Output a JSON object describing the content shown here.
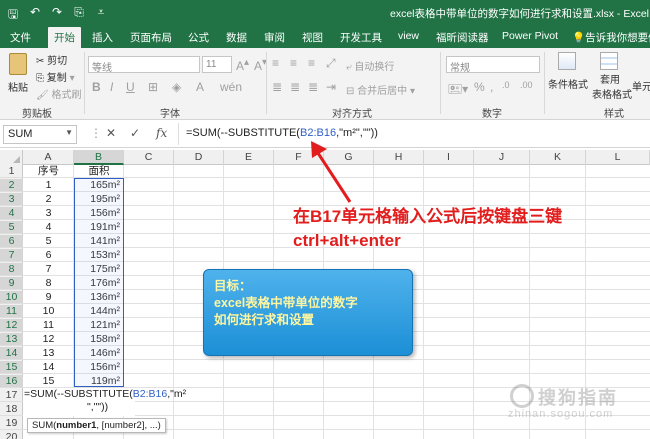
{
  "window": {
    "title": "excel表格中带单位的数字如何进行求和设置.xlsx - Excel"
  },
  "tabs": [
    "文件",
    "开始",
    "插入",
    "页面布局",
    "公式",
    "数据",
    "审阅",
    "视图",
    "开发工具",
    "view",
    "福昕阅读器",
    "Power Pivot",
    "告诉我你想要做什"
  ],
  "active_tab": "开始",
  "ribbon": {
    "paste": "粘贴",
    "cut": "剪切",
    "copy": "复制",
    "format_painter": "格式刷",
    "clipboard_group": "剪贴板",
    "font_name": "等线",
    "font_size": "11",
    "font_group": "字体",
    "wrap_text": "自动换行",
    "merge_center": "合并后居中",
    "alignment_group": "对齐方式",
    "number_format": "常规",
    "number_group": "数字",
    "conditional_format": "条件格式",
    "format_as_table_line1": "套用",
    "format_as_table_line2": "表格格式",
    "cell_styles": "单元",
    "styles_group": "样式"
  },
  "formula_bar": {
    "name_box": "SUM",
    "formula_prefix": "=SUM(--SUBSTITUTE(",
    "formula_ref": "B2:B16",
    "formula_suffix": ",\"m²\",\"\"))"
  },
  "columns": [
    "A",
    "B",
    "C",
    "D",
    "E",
    "F",
    "G",
    "H",
    "I",
    "J",
    "K",
    "L"
  ],
  "rows": [
    {
      "num": "1",
      "a": "序号",
      "b": "面积"
    },
    {
      "num": "2",
      "a": "1",
      "b": "165m²"
    },
    {
      "num": "3",
      "a": "2",
      "b": "195m²"
    },
    {
      "num": "4",
      "a": "3",
      "b": "156m²"
    },
    {
      "num": "5",
      "a": "4",
      "b": "191m²"
    },
    {
      "num": "6",
      "a": "5",
      "b": "141m²"
    },
    {
      "num": "7",
      "a": "6",
      "b": "153m²"
    },
    {
      "num": "8",
      "a": "7",
      "b": "175m²"
    },
    {
      "num": "9",
      "a": "8",
      "b": "176m²"
    },
    {
      "num": "10",
      "a": "9",
      "b": "136m²"
    },
    {
      "num": "11",
      "a": "10",
      "b": "144m²"
    },
    {
      "num": "12",
      "a": "11",
      "b": "121m²"
    },
    {
      "num": "13",
      "a": "12",
      "b": "158m²"
    },
    {
      "num": "14",
      "a": "13",
      "b": "146m²"
    },
    {
      "num": "15",
      "a": "14",
      "b": "156m²"
    },
    {
      "num": "16",
      "a": "15",
      "b": "119m²"
    },
    {
      "num": "17",
      "a": "",
      "b": ""
    },
    {
      "num": "18",
      "a": "",
      "b": ""
    },
    {
      "num": "19",
      "a": "",
      "b": ""
    },
    {
      "num": "20",
      "a": "",
      "b": ""
    }
  ],
  "cell_edit": {
    "line1_prefix": "=SUM(--SUBSTITUTE(",
    "line1_ref": "B2:B16",
    "line1_suffix": ",\"m²",
    "line2": "\",\"\"))"
  },
  "tooltip": {
    "fn": "SUM(",
    "arg1": "number1",
    "rest": ", [number2], ...)"
  },
  "annotations": {
    "instruction_line1": "在B17单元格输入公式后按键盘三键",
    "instruction_line2": "ctrl+alt+enter",
    "goal_title": "目标：",
    "goal_line1": "excel表格中带单位的数字",
    "goal_line2": "如何进行求和设置"
  },
  "watermark": {
    "main": "搜狗指南",
    "sub": "zhinan.sogou.com"
  },
  "colors": {
    "excel_green": "#217346",
    "annotation_red": "#e21d1d",
    "goal_box_blue": "#1c8fd6",
    "goal_text_yellow": "#fff6a0",
    "reference_blue": "#2f5fc4"
  }
}
